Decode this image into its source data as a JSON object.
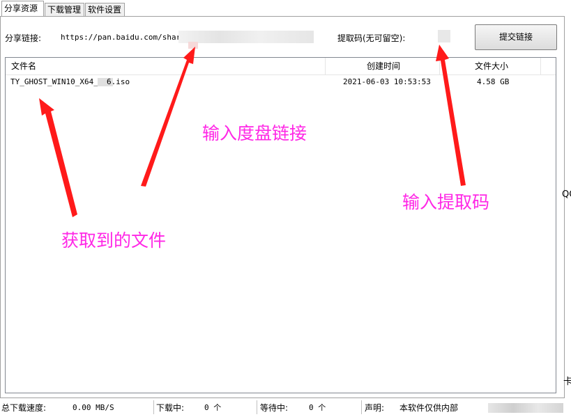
{
  "tabs": [
    {
      "label": "分享资源",
      "active": true
    },
    {
      "label": "下载管理",
      "active": false
    },
    {
      "label": "软件设置",
      "active": false
    }
  ],
  "share": {
    "link_label": "分享链接:",
    "link_value": "https://pan.baidu.com/share/",
    "code_label": "提取码(无可留空):",
    "submit_label": "提交链接"
  },
  "table": {
    "columns": [
      "文件名",
      "创建时间",
      "文件大小"
    ],
    "rows": [
      {
        "name_prefix": "TY_GHOST_WIN10_X64_",
        "name_suffix": "6.iso",
        "created": "2021-06-03 10:53:53",
        "size": "4.58 GB"
      }
    ]
  },
  "annotations": {
    "file": "获取到的文件",
    "link": "输入度盘链接",
    "code": "输入提取码"
  },
  "status": {
    "speed_label": "总下载速度:",
    "speed_value": "0.00 MB/S",
    "downloading_label": "下载中:",
    "downloading_value": "0 个",
    "waiting_label": "等待中:",
    "waiting_value": "0 个",
    "notice_label": "声明:",
    "notice_value": "本软件仅供内部"
  },
  "edge_fragments": {
    "right_top": "QQ",
    "right_bottom": "卡"
  },
  "colors": {
    "annotation": "#ff28e6",
    "arrow": "#ff1a1a"
  }
}
